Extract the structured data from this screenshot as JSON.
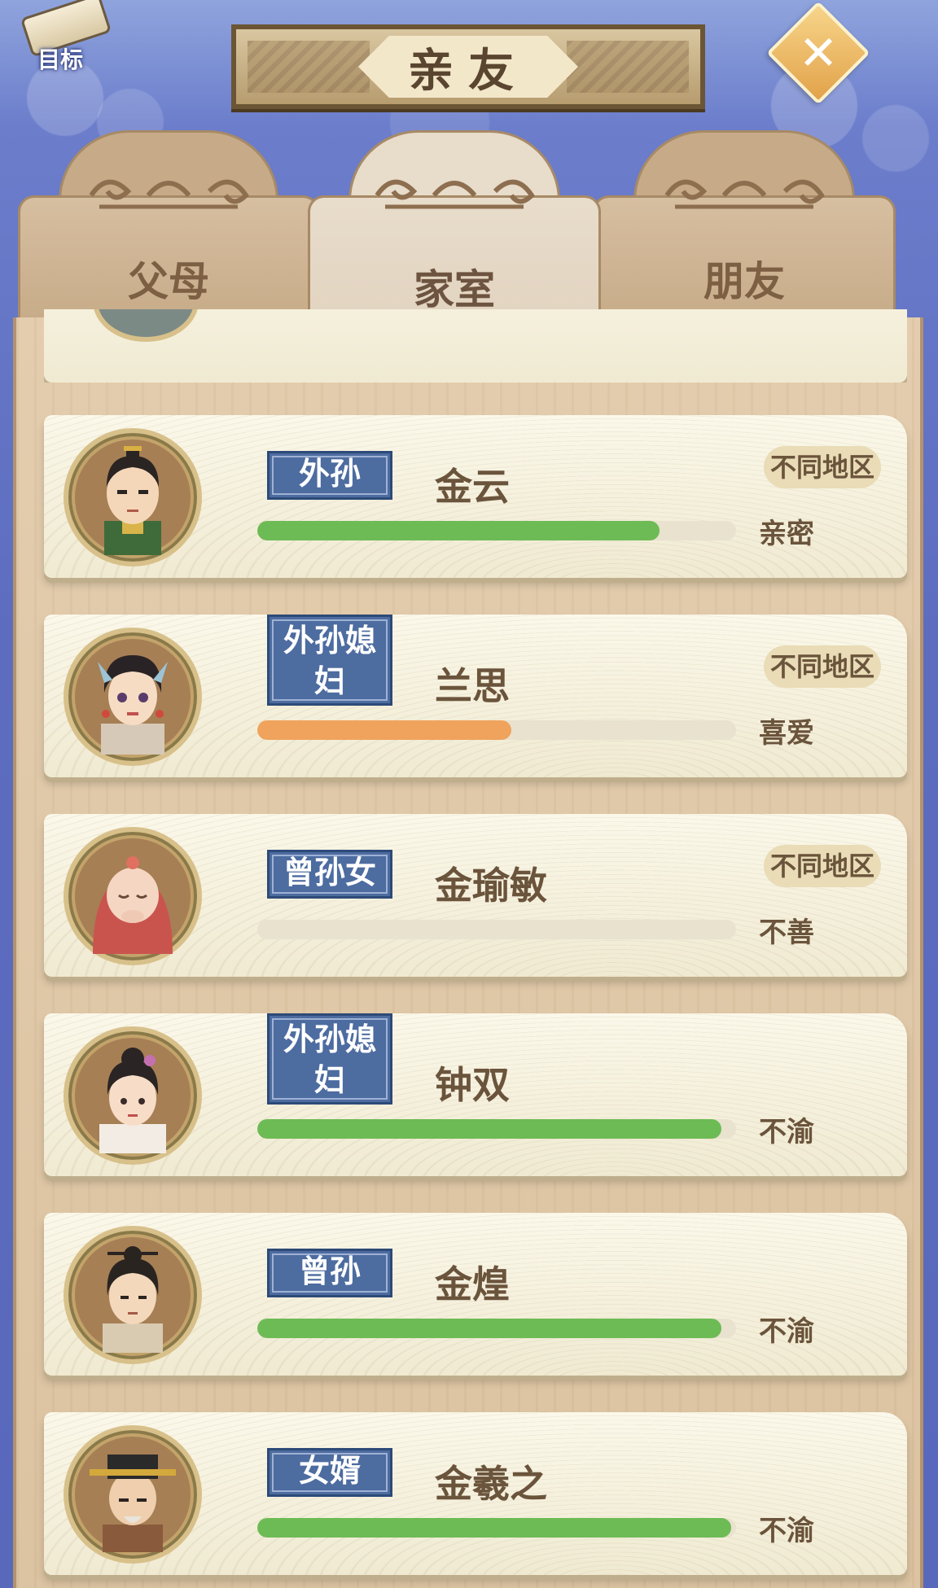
{
  "header": {
    "goal_label": "目标",
    "title": "亲友",
    "close_label": "✕"
  },
  "tabs": [
    {
      "label": "父母",
      "active": false
    },
    {
      "label": "家室",
      "active": true
    },
    {
      "label": "朋友",
      "active": false
    }
  ],
  "colors": {
    "green": "#6dbb55",
    "orange": "#f0a35c",
    "badge": "#4d6ca0"
  },
  "relatives": [
    {
      "relation": "外孙",
      "name": "金云",
      "region": "不同地区",
      "mood": "亲密",
      "affinity": 0.84,
      "bar_color": "#6dbb55",
      "avatar": "male-official-icon"
    },
    {
      "relation": "外孙媳妇",
      "name": "兰思",
      "region": "不同地区",
      "mood": "喜爱",
      "affinity": 0.53,
      "bar_color": "#f0a35c",
      "avatar": "female-ornate-icon"
    },
    {
      "relation": "曾孙女",
      "name": "金瑜敏",
      "region": "不同地区",
      "mood": "不善",
      "affinity": 0.0,
      "bar_color": "#6dbb55",
      "avatar": "baby-icon"
    },
    {
      "relation": "外孙媳妇",
      "name": "钟双",
      "region": "",
      "mood": "不渝",
      "affinity": 0.97,
      "bar_color": "#6dbb55",
      "avatar": "female-young-icon"
    },
    {
      "relation": "曾孙",
      "name": "金煌",
      "region": "",
      "mood": "不渝",
      "affinity": 0.97,
      "bar_color": "#6dbb55",
      "avatar": "male-young-icon"
    },
    {
      "relation": "女婿",
      "name": "金羲之",
      "region": "",
      "mood": "不渝",
      "affinity": 0.99,
      "bar_color": "#6dbb55",
      "avatar": "male-elder-icon"
    }
  ]
}
